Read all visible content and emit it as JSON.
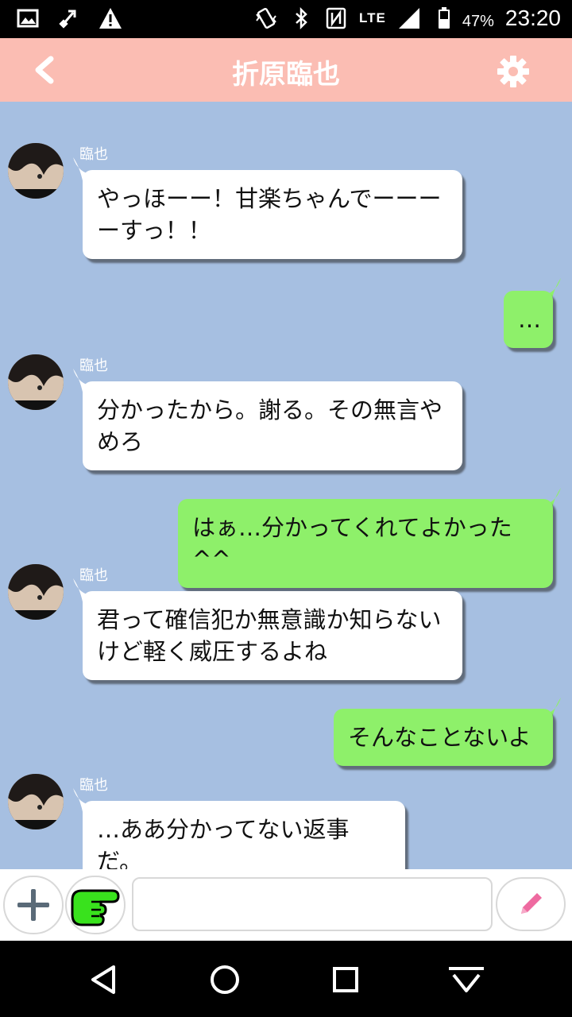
{
  "status_bar": {
    "icons_left": [
      "image-icon",
      "usb-icon",
      "warning-icon"
    ],
    "icons_right": [
      "vibrate-icon",
      "bluetooth-icon",
      "nfc-icon",
      "signal-icon",
      "battery-icon"
    ],
    "network": "LTE",
    "battery": "47%",
    "time": "23:20"
  },
  "header": {
    "title": "折原臨也",
    "back_icon": "chevron-left-icon",
    "settings_icon": "gear-icon",
    "bg_color": "#fbbdb3"
  },
  "chat": {
    "bg_color": "#a6bfe1",
    "messages": [
      {
        "side": "in",
        "sender": "臨也",
        "lines": [
          "やっほーー！甘楽ちゃんでーーー",
          "ーすっ！！"
        ]
      },
      {
        "side": "out",
        "lines": [
          "…"
        ]
      },
      {
        "side": "in",
        "sender": "臨也",
        "lines": [
          "分かったから。謝る。その無言や",
          "めろ"
        ]
      },
      {
        "side": "out",
        "lines": [
          "はぁ…分かってくれてよかった^^"
        ]
      },
      {
        "side": "in",
        "sender": "臨也",
        "lines": [
          "君って確信犯か無意識か知らない",
          "けど軽く威圧するよね"
        ]
      },
      {
        "side": "out",
        "lines": [
          "そんなことないよ"
        ]
      },
      {
        "side": "in",
        "sender": "臨也",
        "lines": [
          "…ああ分かってない返事だ。"
        ]
      }
    ]
  },
  "input_bar": {
    "add_icon": "plus-icon",
    "sticker_icon": "pointing-hand-icon",
    "text_value": "",
    "send_icon": "pencil-icon"
  },
  "nav_bar": {
    "icons": [
      "back-triangle-icon",
      "home-circle-icon",
      "recents-square-icon",
      "keyboard-hide-icon"
    ]
  }
}
